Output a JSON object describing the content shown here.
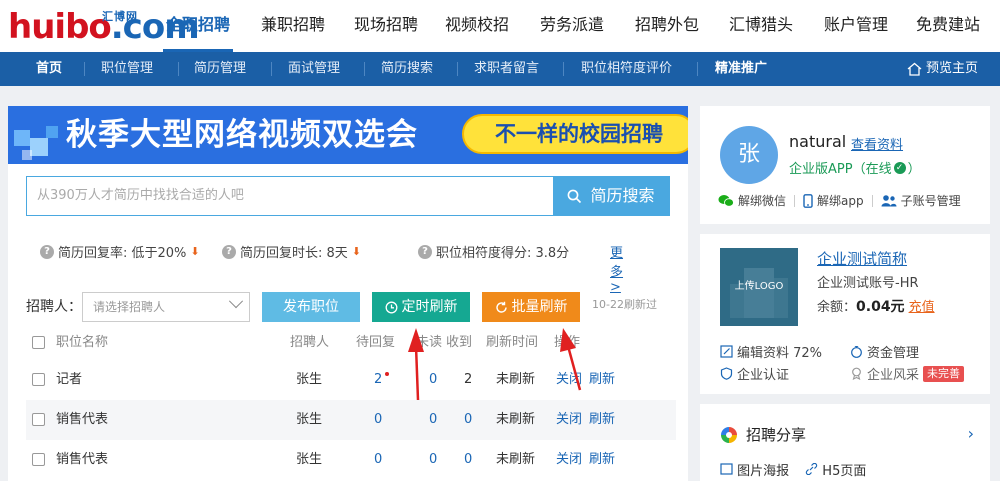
{
  "logo": {
    "brand_part1": "huibo",
    "brand_part2": ".com",
    "brand_cn": "汇博网"
  },
  "main_nav": [
    "全职招聘",
    "兼职招聘",
    "现场招聘",
    "视频校招",
    "劳务派遣",
    "招聘外包",
    "汇博猎头",
    "账户管理",
    "免费建站"
  ],
  "sub_nav": [
    "首页",
    "职位管理",
    "简历管理",
    "面试管理",
    "简历搜索",
    "求职者留言",
    "职位相符度评价",
    "精准推广"
  ],
  "preview_label": "预览主页",
  "banner": {
    "title": "秋季大型网络视频双选会",
    "pill": "不一样的校园招聘"
  },
  "search": {
    "placeholder": "从390万人才简历中找找合适的人吧",
    "button": "简历搜索"
  },
  "stats": {
    "reply_rate": "简历回复率: 低于20%",
    "reply_time": "简历回复时长: 8天",
    "match_score": "职位相符度得分: 3.8分",
    "more": "更多>"
  },
  "toolbar": {
    "recruiter_label": "招聘人：",
    "recruiter_placeholder": "请选择招聘人",
    "publish": "发布职位",
    "timed_refresh": "定时刷新",
    "batch_refresh": "批量刷新",
    "note": "10-22刷新过"
  },
  "table": {
    "headers": [
      "职位名称",
      "招聘人",
      "待回复",
      "未读",
      "收到",
      "刷新时间",
      "操作"
    ],
    "rows": [
      {
        "title": "记者",
        "recruiter": "张生",
        "pending": "2",
        "unread": "0",
        "received": "2",
        "refresh": "未刷新",
        "close": "关闭",
        "refresh_action": "刷新"
      },
      {
        "title": "销售代表",
        "recruiter": "张生",
        "pending": "0",
        "unread": "0",
        "received": "0",
        "refresh": "未刷新",
        "close": "关闭",
        "refresh_action": "刷新"
      },
      {
        "title": "销售代表",
        "recruiter": "张生",
        "pending": "0",
        "unread": "0",
        "received": "0",
        "refresh": "未刷新",
        "close": "关闭",
        "refresh_action": "刷新"
      }
    ]
  },
  "profile": {
    "avatar_char": "张",
    "name": "natural",
    "view_link": "查看资料",
    "app_status": "企业版APP（在线",
    "app_status_end": "）",
    "bind_wechat": "解绑微信",
    "bind_app": "解绑app",
    "sub_accounts": "子账号管理"
  },
  "company": {
    "logo_text": "上传LOGO",
    "name": "企业测试简称",
    "account": "企业测试账号-HR",
    "balance_label": "余额：",
    "balance_value": "0.04元",
    "recharge": "充值",
    "edit_profile": "编辑资料 72%",
    "fund_mgmt": "资金管理",
    "cert": "企业认证",
    "style": "企业风采",
    "style_badge": "未完善"
  },
  "share": {
    "title": "招聘分享",
    "poster": "图片海报",
    "h5": "H5页面"
  },
  "colors": {
    "brand_blue": "#1a66b5",
    "subnav_bg": "#1b5fa6",
    "accent_orange": "#f08a1a",
    "accent_teal": "#15a892",
    "search_blue": "#4aa8e0"
  }
}
